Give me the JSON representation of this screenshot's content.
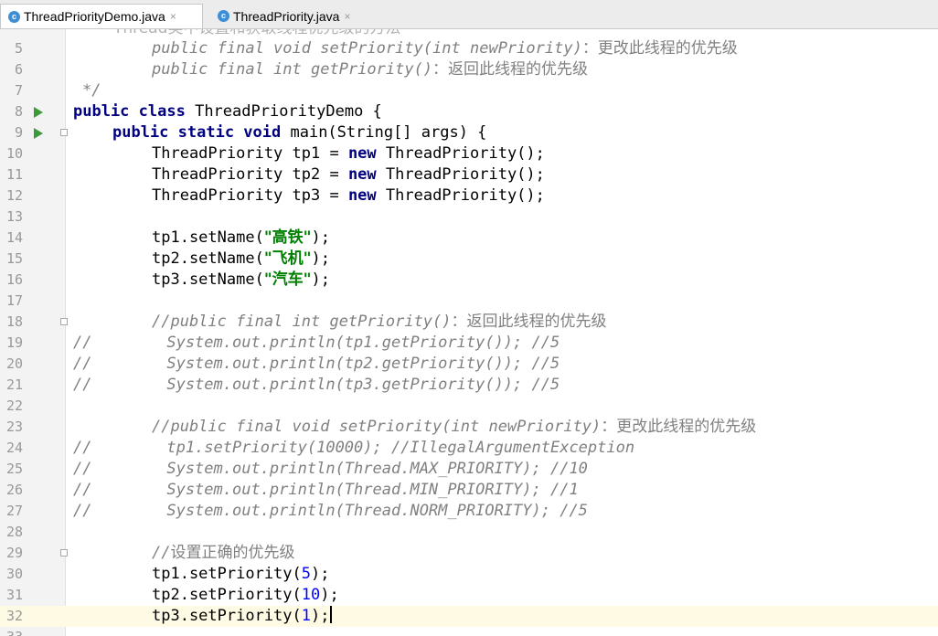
{
  "tabs": [
    {
      "label": "ThreadPriorityDemo.java",
      "icon": "class-icon",
      "active": true
    },
    {
      "label": "ThreadPriority.java",
      "icon": "class-icon",
      "active": false
    }
  ],
  "tab_close_glyph": "×",
  "class_icon_glyph": "c",
  "colors": {
    "keyword": "#000080",
    "comment": "#808080",
    "string": "#008000",
    "number": "#0000ff",
    "current_line": "#fffae3"
  },
  "editor": {
    "first_line_partial": "Thread类中设置和获取线程优先级的方法",
    "lines": [
      {
        "n": "5",
        "comment_code": "public final void setPriority(int newPriority)",
        "comment_zh": "：更改此线程的优先级"
      },
      {
        "n": "6",
        "comment_code": "public final int getPriority()",
        "comment_zh": "：返回此线程的优先级"
      },
      {
        "n": "7",
        "comment_code": "*/"
      },
      {
        "n": "8",
        "kw": "public class",
        "text": "ThreadPriorityDemo {"
      },
      {
        "n": "9",
        "kw": "public static void",
        "text": "main(String[] args) {"
      },
      {
        "n": "10",
        "a": "ThreadPriority tp1 = ",
        "kw": "new",
        "b": " ThreadPriority();"
      },
      {
        "n": "11",
        "a": "ThreadPriority tp2 = ",
        "kw": "new",
        "b": " ThreadPriority();"
      },
      {
        "n": "12",
        "a": "ThreadPriority tp3 = ",
        "kw": "new",
        "b": " ThreadPriority();"
      },
      {
        "n": "13"
      },
      {
        "n": "14",
        "a": "tp1.setName(",
        "str": "\"高铁\"",
        "b": ");"
      },
      {
        "n": "15",
        "a": "tp2.setName(",
        "str": "\"飞机\"",
        "b": ");"
      },
      {
        "n": "16",
        "a": "tp3.setName(",
        "str": "\"汽车\"",
        "b": ");"
      },
      {
        "n": "17"
      },
      {
        "n": "18",
        "comment_code": "//public final int getPriority()",
        "comment_zh": "：返回此线程的优先级"
      },
      {
        "n": "19",
        "comment_code": "//        System.out.println(tp1.getPriority()); //5"
      },
      {
        "n": "20",
        "comment_code": "//        System.out.println(tp2.getPriority()); //5"
      },
      {
        "n": "21",
        "comment_code": "//        System.out.println(tp3.getPriority()); //5"
      },
      {
        "n": "22"
      },
      {
        "n": "23",
        "comment_code": "//public final void setPriority(int newPriority)",
        "comment_zh": "：更改此线程的优先级"
      },
      {
        "n": "24",
        "comment_code": "//        tp1.setPriority(10000); //IllegalArgumentException"
      },
      {
        "n": "25",
        "comment_code": "//        System.out.println(Thread.MAX_PRIORITY); //10"
      },
      {
        "n": "26",
        "comment_code": "//        System.out.println(Thread.MIN_PRIORITY); //1"
      },
      {
        "n": "27",
        "comment_code": "//        System.out.println(Thread.NORM_PRIORITY); //5"
      },
      {
        "n": "28"
      },
      {
        "n": "29",
        "comment_code": "//",
        "comment_zh": "设置正确的优先级"
      },
      {
        "n": "30",
        "a": "tp1.setPriority(",
        "num": "5",
        "b": ");"
      },
      {
        "n": "31",
        "a": "tp2.setPriority(",
        "num": "10",
        "b": ");"
      },
      {
        "n": "32",
        "a": "tp3.setPriority(",
        "num": "1",
        "b": ");"
      },
      {
        "n": "33"
      }
    ]
  }
}
